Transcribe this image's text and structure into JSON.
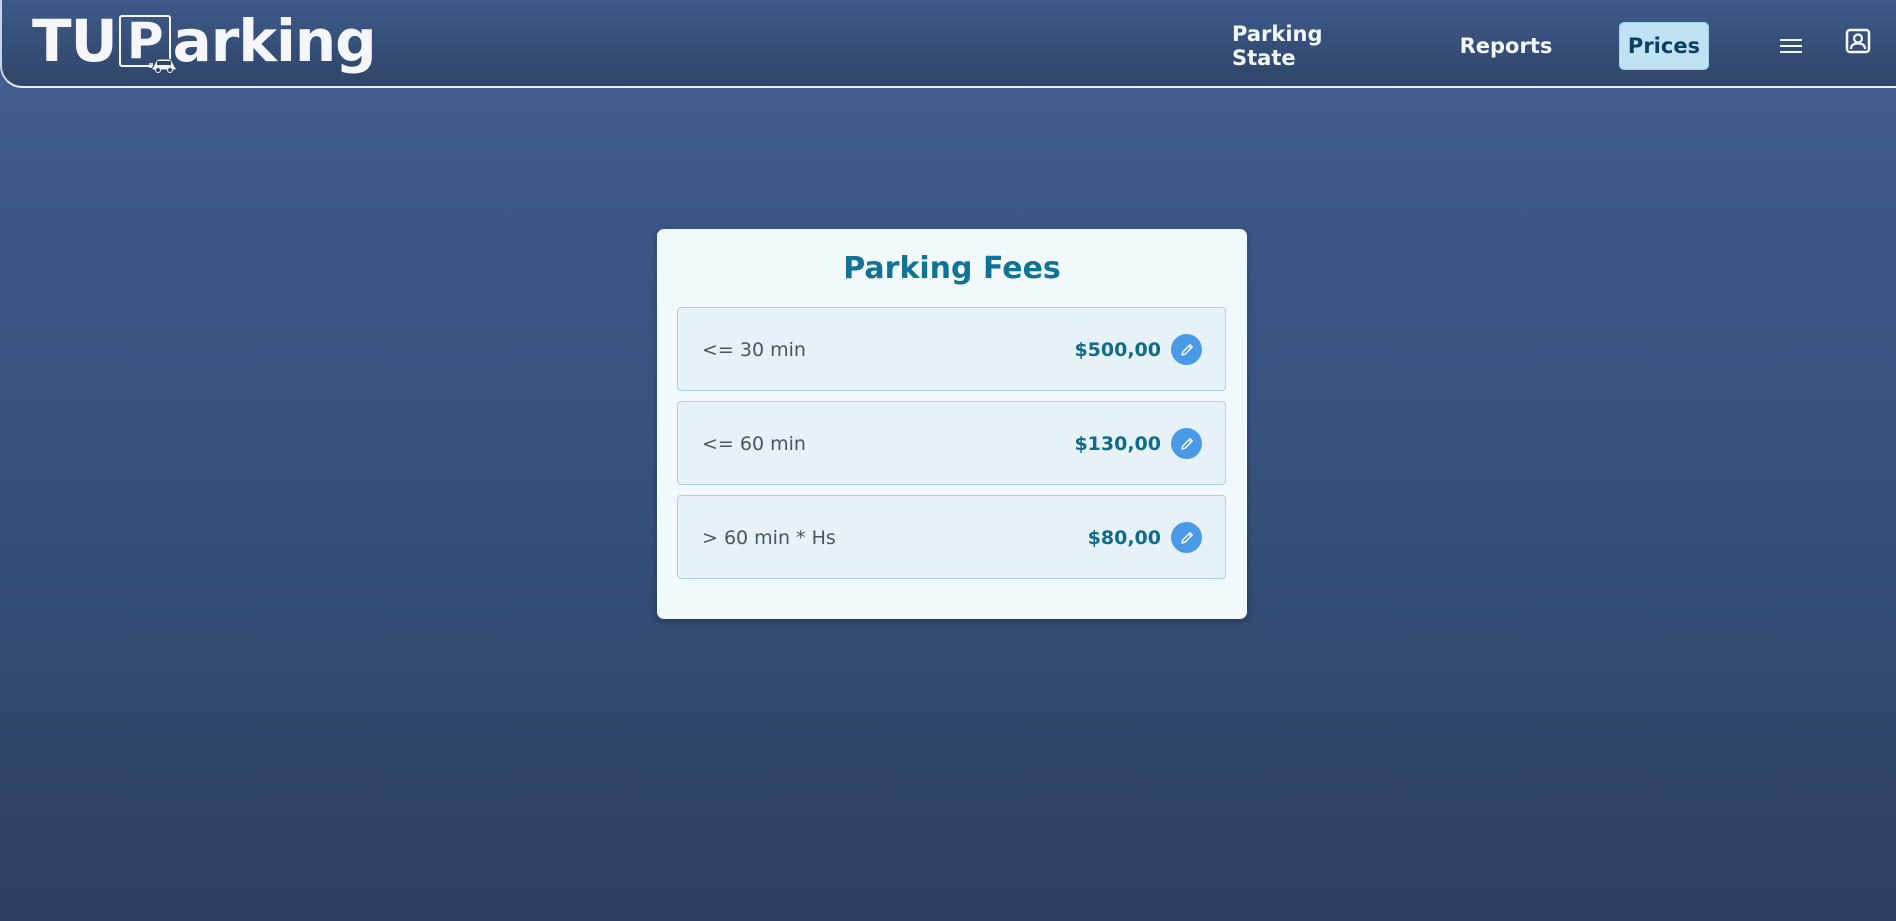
{
  "header": {
    "logo": {
      "part1": "TU",
      "letter": "P",
      "part2": "arking"
    },
    "nav": {
      "parking_state": "Parking State",
      "reports": "Reports",
      "prices": "Prices"
    },
    "icons": {
      "menu": "hamburger-menu-icon",
      "user": "user-profile-icon"
    },
    "active_nav": "Prices"
  },
  "card": {
    "title": "Parking Fees",
    "fees": [
      {
        "label": "<= 30 min",
        "price": "$500,00"
      },
      {
        "label": "<= 60 min",
        "price": "$130,00"
      },
      {
        "label": "> 60 min * Hs",
        "price": "$80,00"
      }
    ]
  },
  "colors": {
    "accent": "#0f7396",
    "active_nav_bg": "#bfe3f5",
    "edit_button": "#4a9ae8"
  }
}
